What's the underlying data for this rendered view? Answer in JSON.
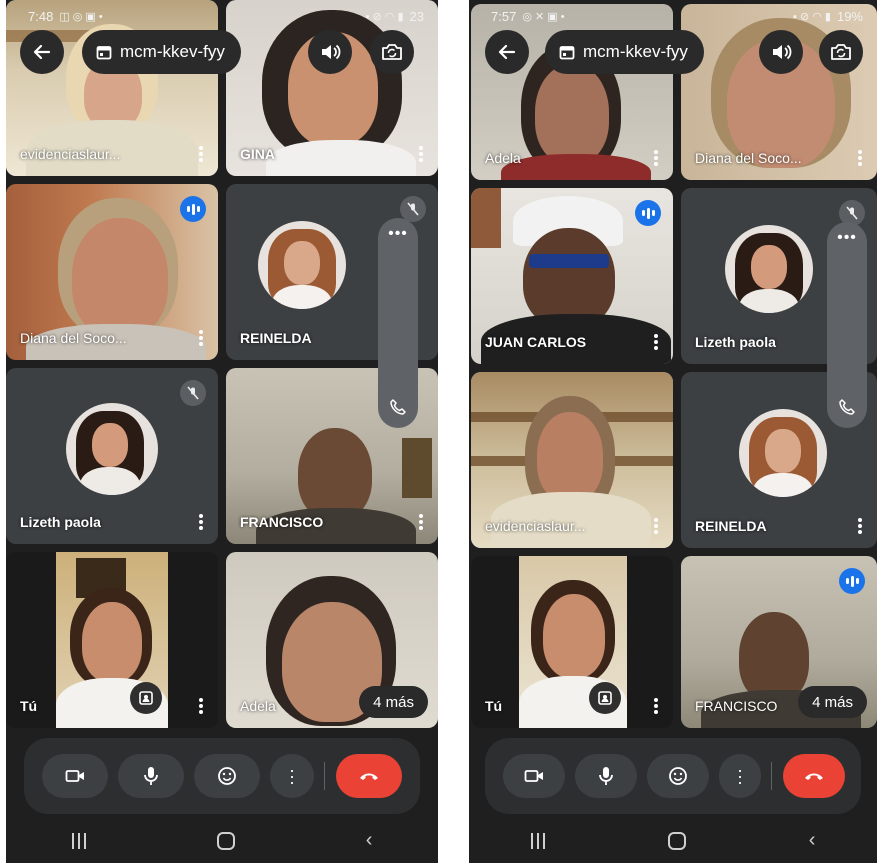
{
  "colors": {
    "background": "#1f1f1f",
    "tile": "#3c4043",
    "active_border": "#8ab4f8",
    "speaking": "#1a73e8",
    "end_call": "#ea4335",
    "control_bar": "#2d2e30"
  },
  "icons": {
    "back": "arrow-left-icon",
    "calendar": "calendar-icon",
    "speaker": "speaker-icon",
    "camera_switch": "camera-switch-icon",
    "camera": "video-camera-icon",
    "mic": "microphone-icon",
    "emoji": "emoji-icon",
    "more": "more-vert-icon",
    "end": "phone-hangup-icon",
    "muted": "mic-off-icon",
    "speaking": "audio-bars-icon",
    "call": "phone-icon",
    "effects": "effects-icon"
  },
  "left_phone": {
    "status_time": "7:48",
    "status_battery": "23",
    "meeting_code": "mcm-kkev-fyy",
    "tiles": [
      {
        "name": "evidenciaslaur..."
      },
      {
        "name": "GINA"
      },
      {
        "name": "Diana del Soco..."
      },
      {
        "name": "REINELDA"
      },
      {
        "name": "Lizeth paola"
      },
      {
        "name": "FRANCISCO"
      },
      {
        "name": "Tú"
      },
      {
        "name": "Adela"
      }
    ],
    "more_count": "4 más"
  },
  "right_phone": {
    "status_time": "7:57",
    "status_battery": "19%",
    "meeting_code": "mcm-kkev-fyy",
    "tiles": [
      {
        "name": "Adela"
      },
      {
        "name": "Diana del Soco..."
      },
      {
        "name": "JUAN CARLOS"
      },
      {
        "name": "Lizeth paola"
      },
      {
        "name": "evidenciaslaur..."
      },
      {
        "name": "REINELDA"
      },
      {
        "name": "Tú"
      },
      {
        "name": "FRANCISCO"
      }
    ],
    "more_count": "4 más"
  }
}
